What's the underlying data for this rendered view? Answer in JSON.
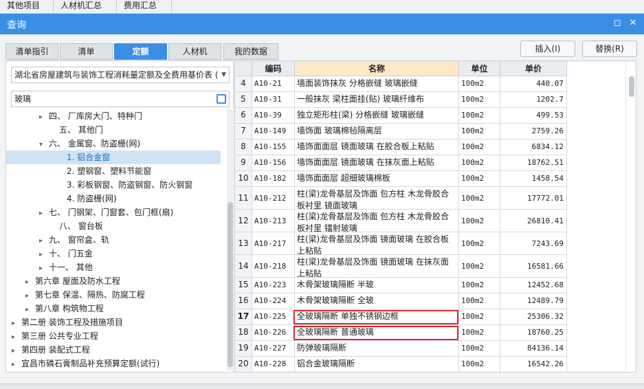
{
  "top_tabs": [
    "其他项目",
    "人材机汇总",
    "费用汇总"
  ],
  "window": {
    "title": "查询",
    "restore_icon": "restore-icon",
    "close_icon": "close-icon"
  },
  "tabs": [
    {
      "label": "清单指引",
      "active": false
    },
    {
      "label": "清单",
      "active": false
    },
    {
      "label": "定额",
      "active": true
    },
    {
      "label": "人材机",
      "active": false
    },
    {
      "label": "我的数据",
      "active": false
    }
  ],
  "buttons": {
    "insert": "插入(I)",
    "replace": "替换(R)"
  },
  "left": {
    "library": "湖北省房屋建筑与装饰工程消耗量定额及全费用基价表 (",
    "search_value": "玻璃",
    "tree": [
      {
        "label": "四、 厂库房大门、特种门",
        "expander": "▸",
        "selected": false
      },
      {
        "label": "五、 其他门",
        "expander": "",
        "selected": false
      },
      {
        "label": "六、 金属窗、防盗栅(网)",
        "expander": "▾",
        "selected": false
      },
      {
        "label": "1. 铝合金窗",
        "expander": "",
        "selected": true
      },
      {
        "label": "2. 塑钢窗、塑料节能窗",
        "expander": "",
        "selected": false
      },
      {
        "label": "3. 彩板钢窗、防盗钢窗、防火钢窗",
        "expander": "",
        "selected": false
      },
      {
        "label": "4. 防盗栅(网)",
        "expander": "",
        "selected": false
      },
      {
        "label": "七、 门钢架、门窗套、包门框(扇)",
        "expander": "▸",
        "selected": false
      },
      {
        "label": "八、 窗台板",
        "expander": "",
        "selected": false
      },
      {
        "label": "九、 窗帘盒、轨",
        "expander": "▸",
        "selected": false
      },
      {
        "label": "十、 门五金",
        "expander": "▸",
        "selected": false
      },
      {
        "label": "十一、 其他",
        "expander": "▸",
        "selected": false
      },
      {
        "label": "第六章 屋面及防水工程",
        "expander": "▸",
        "selected": false
      },
      {
        "label": "第七章 保温、隔热、防腐工程",
        "expander": "▸",
        "selected": false
      },
      {
        "label": "第八章 构筑物工程",
        "expander": "▸",
        "selected": false
      },
      {
        "label": "第二册 装饰工程及措施项目",
        "expander": "▸",
        "selected": false
      },
      {
        "label": "第三册 公共专业工程",
        "expander": "▸",
        "selected": false
      },
      {
        "label": "第四册 装配式工程",
        "expander": "▸",
        "selected": false
      },
      {
        "label": "宜昌市磷石膏制品补充预算定额(试行)",
        "expander": "▸",
        "selected": false
      }
    ]
  },
  "table": {
    "headers": [
      "",
      "编码",
      "名称",
      "单位",
      "单价"
    ],
    "rows": [
      {
        "idx": "4",
        "code": "A10-21",
        "name": "墙面装饰抹灰 分格嵌缝 玻璃嵌缝",
        "unit": "100m2",
        "price": "440.07"
      },
      {
        "idx": "5",
        "code": "A10-31",
        "name": "一般抹灰 梁柱面挂(贴) 玻璃纤维布",
        "unit": "100m2",
        "price": "1202.7"
      },
      {
        "idx": "6",
        "code": "A10-39",
        "name": "独立矩形柱(梁) 分格嵌缝 玻璃嵌缝",
        "unit": "100m2",
        "price": "499.53"
      },
      {
        "idx": "7",
        "code": "A10-149",
        "name": "墙饰面 玻璃棉毡隔离层",
        "unit": "100m2",
        "price": "2759.26"
      },
      {
        "idx": "8",
        "code": "A10-155",
        "name": "墙饰面面层 镜面玻璃 在胶合板上粘贴",
        "unit": "100m2",
        "price": "6834.12"
      },
      {
        "idx": "9",
        "code": "A10-156",
        "name": "墙饰面面层 镜面玻璃 在抹灰面上粘贴",
        "unit": "100m2",
        "price": "18762.51"
      },
      {
        "idx": "10",
        "code": "A10-182",
        "name": "墙饰面面层 超细玻璃棉板",
        "unit": "100m2",
        "price": "1458.54"
      },
      {
        "idx": "11",
        "code": "A10-212",
        "name": "柱(梁)龙骨基层及饰面 包方柱 木龙骨胶合板衬里 镜面玻璃",
        "unit": "100m2",
        "price": "17772.01"
      },
      {
        "idx": "12",
        "code": "A10-213",
        "name": "柱(梁)龙骨基层及饰面 包方柱 木龙骨胶合板衬里 镭射玻璃",
        "unit": "100m2",
        "price": "26810.41"
      },
      {
        "idx": "13",
        "code": "A10-217",
        "name": "柱(梁)龙骨基层及饰面 镜面玻璃 在胶合板上粘贴",
        "unit": "100m2",
        "price": "7243.69"
      },
      {
        "idx": "14",
        "code": "A10-218",
        "name": "柱(梁)龙骨基层及饰面 镜面玻璃 在抹灰面上粘贴",
        "unit": "100m2",
        "price": "16581.66"
      },
      {
        "idx": "15",
        "code": "A10-223",
        "name": "木骨架玻璃隔断 半玻",
        "unit": "100m2",
        "price": "12452.68"
      },
      {
        "idx": "16",
        "code": "A10-224",
        "name": "木骨架玻璃隔断 全玻",
        "unit": "100m2",
        "price": "12489.79"
      },
      {
        "idx": "17",
        "code": "A10-225",
        "name": "全玻璃隔断 单独不锈钢边框",
        "unit": "100m2",
        "price": "25306.32"
      },
      {
        "idx": "18",
        "code": "A10-226",
        "name": "全玻璃隔断 普通玻璃",
        "unit": "100m2",
        "price": "18760.25"
      },
      {
        "idx": "19",
        "code": "A10-227",
        "name": "防弹玻璃隔断",
        "unit": "100m2",
        "price": "84136.14"
      },
      {
        "idx": "20",
        "code": "A10-228",
        "name": "铝合金玻璃隔断",
        "unit": "100m2",
        "price": "16542.26"
      }
    ],
    "current_row_index": "17"
  }
}
